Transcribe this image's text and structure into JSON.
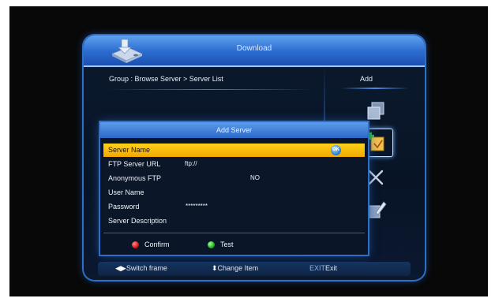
{
  "window": {
    "title": "Download",
    "breadcrumb": "Group : Browse Server > Server List",
    "side_label": "Add"
  },
  "dialog": {
    "title": "Add Server",
    "ok_icon_text": "OK",
    "rows": [
      {
        "label": "Server Name",
        "value": ""
      },
      {
        "label": "FTP Server URL",
        "value": "ftp://"
      },
      {
        "label": "Anonymous FTP",
        "value": "NO"
      },
      {
        "label": "User Name",
        "value": ""
      },
      {
        "label": "Password",
        "value": "*********"
      },
      {
        "label": "Server Description",
        "value": ""
      }
    ],
    "selected_row": "Server Name",
    "confirm_label": "Confirm",
    "test_label": "Test"
  },
  "footer": {
    "switch_frame": "Switch frame",
    "change_item": "Change Item",
    "exit_key": "EXIT",
    "exit_label": "Exit"
  },
  "icons": {
    "download": "download-icon",
    "copy": "copy-icon",
    "add": "add-folder-icon",
    "delete": "delete-icon",
    "edit": "edit-icon",
    "ok": "ok-icon",
    "switch": "left-right-arrows-icon",
    "change": "up-down-arrows-icon"
  },
  "colors": {
    "selection": "#f3b400",
    "confirm": "#d01010",
    "test": "#18b018",
    "accent": "#2f6fc6"
  }
}
